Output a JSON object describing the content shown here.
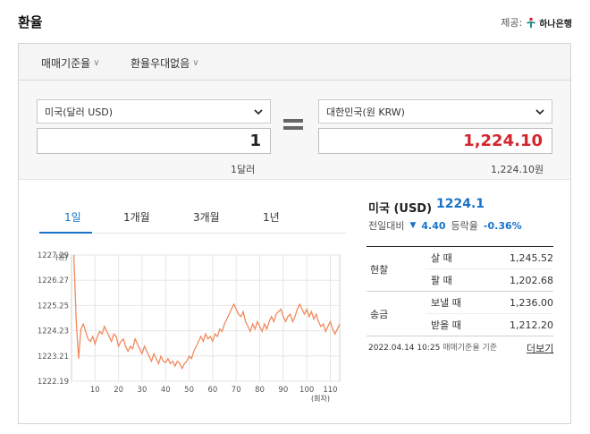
{
  "header": {
    "title": "환율",
    "provider_label": "제공:",
    "provider_name": "하나은행"
  },
  "filters": {
    "rate_type": "매매기준율",
    "preferential": "환율우대없음"
  },
  "converter": {
    "from_currency": "미국(달러 USD)",
    "to_currency": "대한민국(원 KRW)",
    "from_amount": "1",
    "to_amount": "1,224.10",
    "from_unit": "1달러",
    "to_unit": "1,224.10원"
  },
  "tabs": [
    "1일",
    "1개월",
    "3개월",
    "1년"
  ],
  "quote": {
    "name": "미국 (USD)",
    "price": "1224.1",
    "change_label": "전일대비",
    "change_value": "4.40",
    "change_rate_label": "등락율",
    "change_rate": "-0.36%"
  },
  "rates": {
    "cash_label": "현찰",
    "transfer_label": "송금",
    "cash_buy_label": "살 때",
    "cash_buy": "1,245.52",
    "cash_sell_label": "팔 때",
    "cash_sell": "1,202.68",
    "send_label": "보낼 때",
    "send": "1,236.00",
    "receive_label": "받을 때",
    "receive": "1,212.20"
  },
  "footer": {
    "timestamp": "2022.04.14 10:25",
    "basis": "매매기준율 기준",
    "more_link": "더보기"
  },
  "colors": {
    "accent_blue": "#1a73c9",
    "amount_red": "#d4252e",
    "line": "#f08a5d"
  },
  "chart_data": {
    "type": "line",
    "xlabel": "(회차)",
    "ylabel": "(원)",
    "x_ticks": [
      10,
      20,
      30,
      40,
      50,
      60,
      70,
      80,
      90,
      100,
      110
    ],
    "y_ticks": [
      "1227.29",
      "1226.27",
      "1225.25",
      "1224.23",
      "1223.21",
      "1222.19"
    ],
    "xlim": [
      0,
      114
    ],
    "ylim": [
      1222.19,
      1227.29
    ],
    "series": [
      {
        "values": [
          1227.29,
          1224.6,
          1223.1,
          1224.3,
          1224.5,
          1224.2,
          1223.9,
          1223.8,
          1224.0,
          1223.7,
          1224.0,
          1224.2,
          1224.1,
          1224.4,
          1224.2,
          1224.0,
          1223.8,
          1224.1,
          1224.0,
          1223.6,
          1223.8,
          1223.9,
          1223.6,
          1223.4,
          1223.6,
          1223.5,
          1223.9,
          1223.7,
          1223.5,
          1223.3,
          1223.6,
          1223.4,
          1223.2,
          1223.0,
          1223.3,
          1223.1,
          1222.9,
          1223.2,
          1223.0,
          1222.95,
          1223.1,
          1222.9,
          1223.0,
          1222.8,
          1223.0,
          1222.9,
          1222.7,
          1222.9,
          1223.0,
          1223.2,
          1223.1,
          1223.4,
          1223.6,
          1223.8,
          1224.0,
          1223.8,
          1224.1,
          1223.9,
          1224.0,
          1223.8,
          1224.1,
          1224.0,
          1224.3,
          1224.2,
          1224.5,
          1224.7,
          1224.9,
          1225.1,
          1225.3,
          1225.1,
          1224.9,
          1224.8,
          1225.0,
          1224.6,
          1224.4,
          1224.2,
          1224.5,
          1224.3,
          1224.6,
          1224.4,
          1224.2,
          1224.5,
          1224.3,
          1224.6,
          1224.8,
          1224.6,
          1224.9,
          1225.0,
          1225.1,
          1224.8,
          1224.6,
          1224.8,
          1224.9,
          1224.6,
          1224.8,
          1225.1,
          1225.3,
          1225.1,
          1224.9,
          1225.1,
          1224.8,
          1225.0,
          1224.7,
          1224.9,
          1224.6,
          1224.4,
          1224.5,
          1224.2,
          1224.4,
          1224.6,
          1224.3,
          1224.1,
          1224.3,
          1224.5
        ]
      }
    ]
  }
}
